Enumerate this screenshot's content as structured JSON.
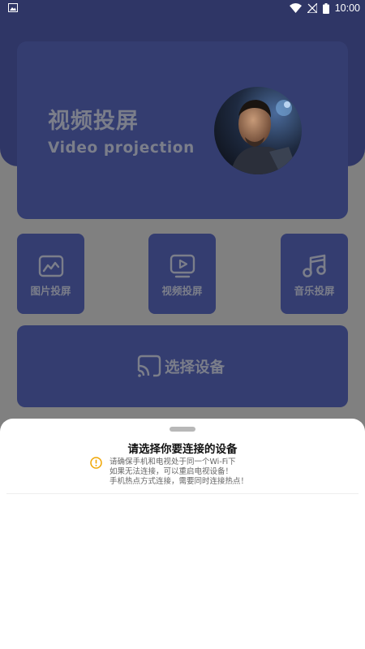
{
  "status_bar": {
    "time": "10:00",
    "icons": [
      "image-notification-icon",
      "wifi-icon",
      "signal-off-icon",
      "battery-icon"
    ]
  },
  "hero": {
    "title": "视频投屏",
    "subtitle": "Video projection"
  },
  "tiles": [
    {
      "label": "图片投屏",
      "icon": "image-icon"
    },
    {
      "label": "视频投屏",
      "icon": "video-play-icon"
    },
    {
      "label": "音乐投屏",
      "icon": "music-note-icon"
    }
  ],
  "select_device": {
    "label": "选择设备",
    "icon": "cast-icon"
  },
  "sheet": {
    "title": "请选择你要连接的设备",
    "notes": [
      "请确保手机和电视处于同一个Wi-Fi下",
      "如果无法连接，可以重启电视设备！",
      "手机热点方式连接，需要同时连接热点！"
    ]
  },
  "colors": {
    "header": "#2f3666",
    "card": "#343d70",
    "overlay": "#808080",
    "muted_text": "#7b7e8a",
    "warning": "#f0a500"
  }
}
